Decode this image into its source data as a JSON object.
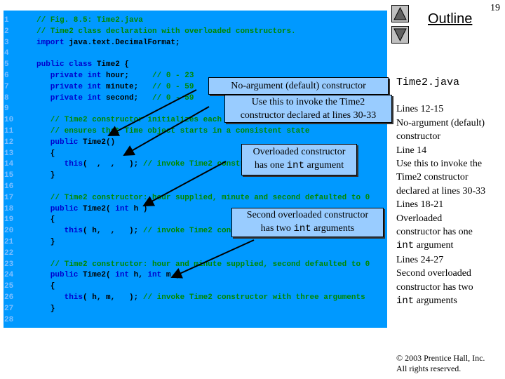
{
  "page_number": "19",
  "outline_label": "Outline",
  "nav": {
    "up_icon": "triangle-up-icon",
    "down_icon": "triangle-down-icon"
  },
  "colors": {
    "code_bg": "#0099ff",
    "callout_bg": "#99ccff",
    "comment": "#008800",
    "keyword": "#0000cc"
  },
  "code_lines": [
    [
      {
        "t": "// Fig. 8.5: Time2.java",
        "s": "c"
      }
    ],
    [
      {
        "t": "// Time2 class declaration with overloaded constructors.",
        "s": "c"
      }
    ],
    [
      {
        "t": "import",
        "s": "k"
      },
      {
        "t": " java.text.DecimalFormat;"
      }
    ],
    [],
    [
      {
        "t": "public class",
        "s": "k"
      },
      {
        "t": " Time2 {"
      }
    ],
    [
      {
        "t": "   private int",
        "s": "k"
      },
      {
        "t": " hour;     "
      },
      {
        "t": "// 0 - 23",
        "s": "c"
      }
    ],
    [
      {
        "t": "   private int",
        "s": "k"
      },
      {
        "t": " minute;   "
      },
      {
        "t": "// 0 - 59",
        "s": "c"
      }
    ],
    [
      {
        "t": "   private int",
        "s": "k"
      },
      {
        "t": " second;   "
      },
      {
        "t": "// 0 - 59",
        "s": "c"
      }
    ],
    [],
    [
      {
        "t": "   // Time2 constructor initializes each",
        "s": "c"
      }
    ],
    [
      {
        "t": "   // ensures that Time object starts in a consistent state",
        "s": "c"
      }
    ],
    [
      {
        "t": "   public",
        "s": "k"
      },
      {
        "t": " Time2()"
      }
    ],
    [
      {
        "t": "   {"
      }
    ],
    [
      {
        "t": "      this",
        "s": "k"
      },
      {
        "t": "(  ,  ,   ); "
      },
      {
        "t": "// invoke Time2 constr",
        "s": "c"
      }
    ],
    [
      {
        "t": "   }"
      }
    ],
    [],
    [
      {
        "t": "   // Time2 constructor: hour supplied, minute and second defaulted to 0",
        "s": "c"
      }
    ],
    [
      {
        "t": "   public",
        "s": "k"
      },
      {
        "t": " Time2( "
      },
      {
        "t": "int",
        "s": "k"
      },
      {
        "t": " h )"
      }
    ],
    [
      {
        "t": "   {"
      }
    ],
    [
      {
        "t": "      this",
        "s": "k"
      },
      {
        "t": "( h,  ,   ); "
      },
      {
        "t": "// invoke Time2 con",
        "s": "c"
      }
    ],
    [
      {
        "t": "   }"
      }
    ],
    [],
    [
      {
        "t": "   // Time2 constructor: hour and minute supplied, second defaulted to 0",
        "s": "c"
      }
    ],
    [
      {
        "t": "   public",
        "s": "k"
      },
      {
        "t": " Time2( "
      },
      {
        "t": "int",
        "s": "k"
      },
      {
        "t": " h, "
      },
      {
        "t": "int",
        "s": "k"
      },
      {
        "t": " m )"
      }
    ],
    [
      {
        "t": "   {"
      }
    ],
    [
      {
        "t": "      this",
        "s": "k"
      },
      {
        "t": "( h, m,   ); "
      },
      {
        "t": "// invoke Time2 constructor with three arguments",
        "s": "c"
      }
    ],
    [
      {
        "t": "   }"
      }
    ],
    []
  ],
  "callouts": {
    "c1": "No-argument (default) constructor",
    "c2a": "Use this to invoke the Time2",
    "c2b": "constructor declared at lines 30-33",
    "c3a": "Overloaded constructor",
    "c3b_pre": "has one ",
    "c3b_code": "int",
    "c3b_post": " argument",
    "c4a": "Second overloaded constructor",
    "c4b_pre": "has two ",
    "c4b_code": "int",
    "c4b_post": " arguments"
  },
  "sidebar": {
    "filename": "Time2.java",
    "lines": [
      {
        "t": "Lines 12-15"
      },
      {
        "t": "No-argument (default)"
      },
      {
        "t": "constructor"
      },
      {
        "t": "Line 14"
      },
      {
        "t": "Use this to invoke the"
      },
      {
        "t": "Time2 constructor"
      },
      {
        "t": "declared at lines 30-33"
      },
      {
        "t": "Lines 18-21"
      },
      {
        "t": "Overloaded"
      },
      {
        "t": "constructor has one"
      },
      {
        "t": "int",
        "m": true,
        "post": " argument"
      },
      {
        "t": "Lines 24-27"
      },
      {
        "t": "Second overloaded"
      },
      {
        "t": "constructor has two"
      },
      {
        "t": "int",
        "m": true,
        "post": " arguments"
      }
    ]
  },
  "copyright": {
    "line1": "© 2003 Prentice Hall, Inc.",
    "line2": "All rights reserved."
  }
}
